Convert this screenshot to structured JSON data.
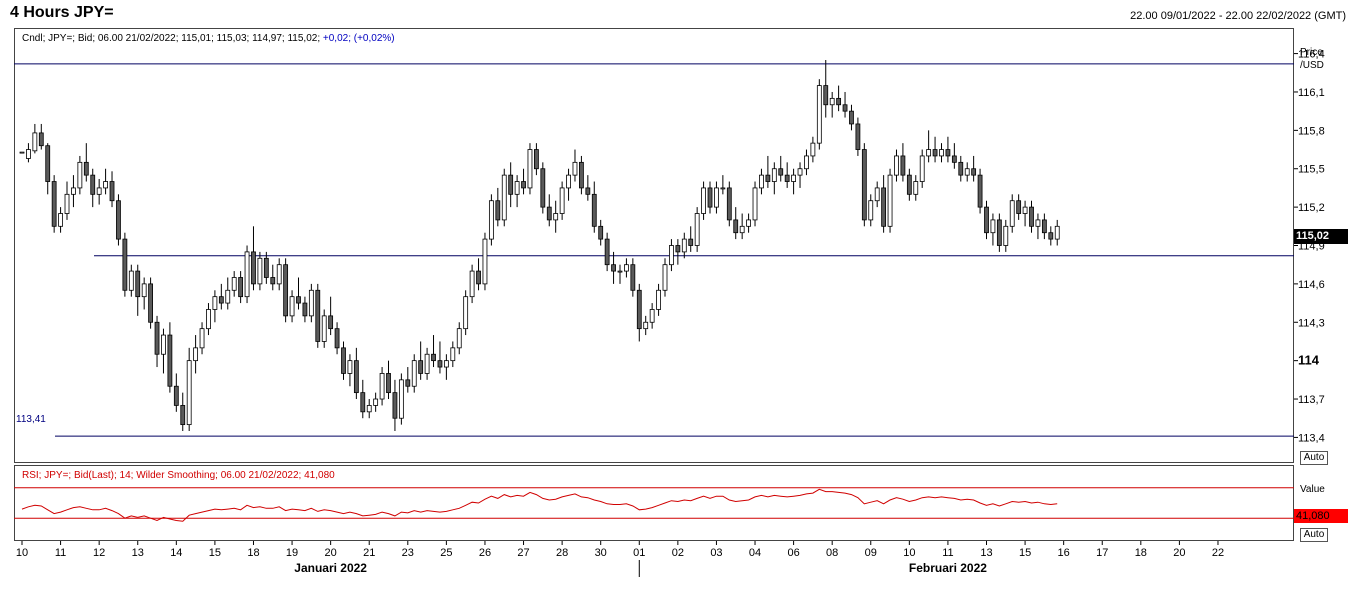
{
  "header": {
    "title": "4 Hours JPY=",
    "date_range": "22.00 09/01/2022 - 22.00 22/02/2022 (GMT)"
  },
  "price_panel": {
    "legend": "Cndl; JPY=; Bid; 06.00 21/02/2022; 115,01; 115,03; 114,97; 115,02;",
    "legend_change": "+0,02; (+0,02%)",
    "axis_title_1": "Price",
    "axis_title_2": "/USD",
    "auto_label": "Auto",
    "last_price_label": "115,02",
    "support_low_label": "113,41"
  },
  "rsi_panel": {
    "legend": "RSI; JPY=; Bid(Last); 14; Wilder Smoothing; 06.00 21/02/2022; 41,080",
    "axis_title": "Value",
    "auto_label": "Auto",
    "last_value_label": "41,080"
  },
  "colors": {
    "bull": "#ffffff",
    "bear": "#5a5a5a",
    "candle_outline": "#000000",
    "hline": "#000060",
    "rsi_line": "#d00000",
    "last_price_bg": "#000000",
    "last_rsi_bg": "#ff0000"
  },
  "chart_data": {
    "type": "candlestick",
    "y_axis": {
      "min": 113.2,
      "max": 116.6,
      "ticks": [
        {
          "value": 113.4,
          "label": "113,4"
        },
        {
          "value": 113.7,
          "label": "113,7"
        },
        {
          "value": 114.0,
          "label": "114",
          "bold": true
        },
        {
          "value": 114.3,
          "label": "114,3"
        },
        {
          "value": 114.6,
          "label": "114,6"
        },
        {
          "value": 114.9,
          "label": "114,9"
        },
        {
          "value": 115.2,
          "label": "115,2"
        },
        {
          "value": 115.5,
          "label": "115,5"
        },
        {
          "value": 115.8,
          "label": "115,8"
        },
        {
          "value": 116.1,
          "label": "116,1"
        },
        {
          "value": 116.4,
          "label": "116,4"
        }
      ]
    },
    "horizontal_lines": [
      116.32,
      114.82,
      113.41
    ],
    "x_axis": {
      "day_ticks": [
        {
          "label": "10",
          "idx": 0
        },
        {
          "label": "11",
          "idx": 6
        },
        {
          "label": "12",
          "idx": 12
        },
        {
          "label": "13",
          "idx": 18
        },
        {
          "label": "14",
          "idx": 24
        },
        {
          "label": "15",
          "idx": 30
        },
        {
          "label": "18",
          "idx": 36
        },
        {
          "label": "19",
          "idx": 42
        },
        {
          "label": "20",
          "idx": 48
        },
        {
          "label": "21",
          "idx": 54
        },
        {
          "label": "23",
          "idx": 60
        },
        {
          "label": "25",
          "idx": 66
        },
        {
          "label": "26",
          "idx": 72
        },
        {
          "label": "27",
          "idx": 78
        },
        {
          "label": "28",
          "idx": 84
        },
        {
          "label": "30",
          "idx": 90
        },
        {
          "label": "01",
          "idx": 96
        },
        {
          "label": "02",
          "idx": 102
        },
        {
          "label": "03",
          "idx": 108
        },
        {
          "label": "04",
          "idx": 114
        },
        {
          "label": "06",
          "idx": 120
        },
        {
          "label": "08",
          "idx": 126
        },
        {
          "label": "09",
          "idx": 132
        },
        {
          "label": "10",
          "idx": 138
        },
        {
          "label": "11",
          "idx": 144
        },
        {
          "label": "13",
          "idx": 150
        },
        {
          "label": "15",
          "idx": 156
        },
        {
          "label": "16",
          "idx": 162
        },
        {
          "label": "17",
          "idx": 168
        },
        {
          "label": "18",
          "idx": 174
        },
        {
          "label": "20",
          "idx": 180
        },
        {
          "label": "22",
          "idx": 186
        }
      ],
      "months": [
        {
          "label": "Januari 2022",
          "idx": 48
        },
        {
          "label": "Februari 2022",
          "idx": 144
        }
      ],
      "month_boundary_idx": 96
    },
    "candles": [
      [
        115.63,
        115.63,
        115.63,
        115.63
      ],
      [
        115.58,
        115.7,
        115.55,
        115.65
      ],
      [
        115.64,
        115.85,
        115.62,
        115.78
      ],
      [
        115.78,
        115.85,
        115.65,
        115.68
      ],
      [
        115.68,
        115.7,
        115.3,
        115.4
      ],
      [
        115.4,
        115.45,
        115.0,
        115.05
      ],
      [
        115.05,
        115.2,
        115.0,
        115.15
      ],
      [
        115.15,
        115.4,
        115.1,
        115.3
      ],
      [
        115.3,
        115.45,
        115.2,
        115.35
      ],
      [
        115.35,
        115.6,
        115.3,
        115.55
      ],
      [
        115.55,
        115.7,
        115.4,
        115.45
      ],
      [
        115.45,
        115.5,
        115.2,
        115.3
      ],
      [
        115.3,
        115.42,
        115.22,
        115.35
      ],
      [
        115.35,
        115.5,
        115.3,
        115.4
      ],
      [
        115.4,
        115.48,
        115.2,
        115.25
      ],
      [
        115.25,
        115.3,
        114.9,
        114.95
      ],
      [
        114.95,
        115.0,
        114.5,
        114.55
      ],
      [
        114.55,
        114.75,
        114.5,
        114.7
      ],
      [
        114.7,
        114.75,
        114.35,
        114.5
      ],
      [
        114.5,
        114.65,
        114.4,
        114.6
      ],
      [
        114.6,
        114.65,
        114.25,
        114.3
      ],
      [
        114.3,
        114.35,
        113.95,
        114.05
      ],
      [
        114.05,
        114.25,
        113.9,
        114.2
      ],
      [
        114.2,
        114.3,
        113.75,
        113.8
      ],
      [
        113.8,
        113.9,
        113.6,
        113.65
      ],
      [
        113.65,
        113.75,
        113.45,
        113.5
      ],
      [
        113.5,
        114.1,
        113.45,
        114.0
      ],
      [
        114.0,
        114.2,
        113.9,
        114.1
      ],
      [
        114.1,
        114.3,
        114.05,
        114.25
      ],
      [
        114.25,
        114.45,
        114.2,
        114.4
      ],
      [
        114.4,
        114.55,
        114.3,
        114.5
      ],
      [
        114.5,
        114.6,
        114.4,
        114.45
      ],
      [
        114.45,
        114.65,
        114.4,
        114.55
      ],
      [
        114.55,
        114.7,
        114.5,
        114.65
      ],
      [
        114.65,
        114.7,
        114.45,
        114.5
      ],
      [
        114.5,
        114.9,
        114.45,
        114.85
      ],
      [
        114.85,
        115.05,
        114.55,
        114.6
      ],
      [
        114.6,
        114.85,
        114.55,
        114.8
      ],
      [
        114.8,
        114.85,
        114.6,
        114.65
      ],
      [
        114.65,
        114.75,
        114.55,
        114.6
      ],
      [
        114.6,
        114.8,
        114.55,
        114.75
      ],
      [
        114.75,
        114.8,
        114.3,
        114.35
      ],
      [
        114.35,
        114.55,
        114.3,
        114.5
      ],
      [
        114.5,
        114.65,
        114.4,
        114.45
      ],
      [
        114.45,
        114.5,
        114.3,
        114.35
      ],
      [
        114.35,
        114.6,
        114.3,
        114.55
      ],
      [
        114.55,
        114.6,
        114.1,
        114.15
      ],
      [
        114.15,
        114.4,
        114.1,
        114.35
      ],
      [
        114.35,
        114.5,
        114.2,
        114.25
      ],
      [
        114.25,
        114.3,
        114.05,
        114.1
      ],
      [
        114.1,
        114.15,
        113.85,
        113.9
      ],
      [
        113.9,
        114.05,
        113.8,
        114.0
      ],
      [
        114.0,
        114.1,
        113.7,
        113.75
      ],
      [
        113.75,
        113.85,
        113.55,
        113.6
      ],
      [
        113.6,
        113.7,
        113.55,
        113.65
      ],
      [
        113.65,
        113.75,
        113.6,
        113.7
      ],
      [
        113.7,
        113.95,
        113.65,
        113.9
      ],
      [
        113.9,
        114.0,
        113.7,
        113.75
      ],
      [
        113.75,
        113.85,
        113.45,
        113.55
      ],
      [
        113.55,
        113.9,
        113.5,
        113.85
      ],
      [
        113.85,
        113.95,
        113.75,
        113.8
      ],
      [
        113.8,
        114.05,
        113.75,
        114.0
      ],
      [
        114.0,
        114.15,
        113.85,
        113.9
      ],
      [
        113.9,
        114.1,
        113.85,
        114.05
      ],
      [
        114.05,
        114.2,
        113.95,
        114.0
      ],
      [
        114.0,
        114.15,
        113.9,
        113.95
      ],
      [
        113.95,
        114.05,
        113.85,
        114.0
      ],
      [
        114.0,
        114.15,
        113.95,
        114.1
      ],
      [
        114.1,
        114.3,
        114.05,
        114.25
      ],
      [
        114.25,
        114.55,
        114.2,
        114.5
      ],
      [
        114.5,
        114.75,
        114.45,
        114.7
      ],
      [
        114.7,
        114.8,
        114.55,
        114.6
      ],
      [
        114.6,
        115.0,
        114.55,
        114.95
      ],
      [
        114.95,
        115.3,
        114.9,
        115.25
      ],
      [
        115.25,
        115.35,
        115.05,
        115.1
      ],
      [
        115.1,
        115.5,
        115.05,
        115.45
      ],
      [
        115.45,
        115.55,
        115.2,
        115.3
      ],
      [
        115.3,
        115.45,
        115.2,
        115.4
      ],
      [
        115.4,
        115.5,
        115.3,
        115.35
      ],
      [
        115.35,
        115.7,
        115.3,
        115.65
      ],
      [
        115.65,
        115.7,
        115.45,
        115.5
      ],
      [
        115.5,
        115.55,
        115.15,
        115.2
      ],
      [
        115.2,
        115.3,
        115.05,
        115.1
      ],
      [
        115.1,
        115.25,
        115.0,
        115.15
      ],
      [
        115.15,
        115.4,
        115.1,
        115.35
      ],
      [
        115.35,
        115.5,
        115.25,
        115.45
      ],
      [
        115.45,
        115.65,
        115.4,
        115.55
      ],
      [
        115.55,
        115.6,
        115.3,
        115.35
      ],
      [
        115.35,
        115.45,
        115.25,
        115.3
      ],
      [
        115.3,
        115.4,
        115.0,
        115.05
      ],
      [
        115.05,
        115.1,
        114.9,
        114.95
      ],
      [
        114.95,
        115.0,
        114.7,
        114.75
      ],
      [
        114.75,
        114.85,
        114.6,
        114.7
      ],
      [
        114.7,
        114.75,
        114.6,
        114.7
      ],
      [
        114.7,
        114.8,
        114.65,
        114.75
      ],
      [
        114.75,
        114.8,
        114.5,
        114.55
      ],
      [
        114.55,
        114.6,
        114.15,
        114.25
      ],
      [
        114.25,
        114.35,
        114.2,
        114.3
      ],
      [
        114.3,
        114.45,
        114.25,
        114.4
      ],
      [
        114.4,
        114.6,
        114.35,
        114.55
      ],
      [
        114.55,
        114.8,
        114.5,
        114.75
      ],
      [
        114.75,
        114.95,
        114.7,
        114.9
      ],
      [
        114.9,
        114.95,
        114.75,
        114.85
      ],
      [
        114.85,
        115.0,
        114.8,
        114.95
      ],
      [
        114.95,
        115.05,
        114.85,
        114.9
      ],
      [
        114.9,
        115.2,
        114.85,
        115.15
      ],
      [
        115.15,
        115.4,
        115.1,
        115.35
      ],
      [
        115.35,
        115.4,
        115.15,
        115.2
      ],
      [
        115.2,
        115.4,
        115.15,
        115.35
      ],
      [
        115.35,
        115.45,
        115.3,
        115.35
      ],
      [
        115.35,
        115.4,
        115.05,
        115.1
      ],
      [
        115.1,
        115.2,
        114.95,
        115.0
      ],
      [
        115.0,
        115.15,
        114.95,
        115.05
      ],
      [
        115.05,
        115.15,
        115.0,
        115.1
      ],
      [
        115.1,
        115.4,
        115.05,
        115.35
      ],
      [
        115.35,
        115.5,
        115.3,
        115.45
      ],
      [
        115.45,
        115.6,
        115.35,
        115.4
      ],
      [
        115.4,
        115.55,
        115.3,
        115.5
      ],
      [
        115.5,
        115.6,
        115.4,
        115.45
      ],
      [
        115.45,
        115.55,
        115.35,
        115.4
      ],
      [
        115.4,
        115.5,
        115.3,
        115.45
      ],
      [
        115.45,
        115.55,
        115.35,
        115.5
      ],
      [
        115.5,
        115.65,
        115.45,
        115.6
      ],
      [
        115.6,
        115.75,
        115.55,
        115.7
      ],
      [
        115.7,
        116.2,
        115.65,
        116.15
      ],
      [
        116.15,
        116.35,
        115.9,
        116.0
      ],
      [
        116.0,
        116.1,
        115.9,
        116.05
      ],
      [
        116.05,
        116.15,
        115.95,
        116.0
      ],
      [
        116.0,
        116.1,
        115.9,
        115.95
      ],
      [
        115.95,
        116.0,
        115.8,
        115.85
      ],
      [
        115.85,
        115.9,
        115.6,
        115.65
      ],
      [
        115.65,
        115.7,
        115.05,
        115.1
      ],
      [
        115.1,
        115.3,
        115.05,
        115.25
      ],
      [
        115.25,
        115.4,
        115.2,
        115.35
      ],
      [
        115.35,
        115.45,
        115.0,
        115.05
      ],
      [
        115.05,
        115.5,
        115.0,
        115.45
      ],
      [
        115.45,
        115.65,
        115.4,
        115.6
      ],
      [
        115.6,
        115.7,
        115.4,
        115.45
      ],
      [
        115.45,
        115.5,
        115.25,
        115.3
      ],
      [
        115.3,
        115.45,
        115.25,
        115.4
      ],
      [
        115.4,
        115.65,
        115.35,
        115.6
      ],
      [
        115.6,
        115.8,
        115.55,
        115.65
      ],
      [
        115.65,
        115.75,
        115.55,
        115.6
      ],
      [
        115.6,
        115.7,
        115.55,
        115.65
      ],
      [
        115.65,
        115.75,
        115.55,
        115.6
      ],
      [
        115.6,
        115.7,
        115.5,
        115.55
      ],
      [
        115.55,
        115.6,
        115.4,
        115.45
      ],
      [
        115.45,
        115.55,
        115.4,
        115.5
      ],
      [
        115.5,
        115.6,
        115.4,
        115.45
      ],
      [
        115.45,
        115.5,
        115.15,
        115.2
      ],
      [
        115.2,
        115.25,
        114.95,
        115.0
      ],
      [
        115.0,
        115.15,
        114.9,
        115.1
      ],
      [
        115.1,
        115.15,
        114.85,
        114.9
      ],
      [
        114.9,
        115.1,
        114.85,
        115.05
      ],
      [
        115.05,
        115.3,
        115.0,
        115.25
      ],
      [
        115.25,
        115.3,
        115.1,
        115.15
      ],
      [
        115.15,
        115.25,
        115.05,
        115.2
      ],
      [
        115.2,
        115.25,
        115.0,
        115.05
      ],
      [
        115.05,
        115.15,
        114.95,
        115.1
      ],
      [
        115.1,
        115.15,
        114.95,
        115.0
      ],
      [
        115.0,
        115.05,
        114.9,
        114.95
      ],
      [
        114.95,
        115.1,
        114.9,
        115.05
      ]
    ],
    "rsi": {
      "min": 0,
      "max": 100,
      "levels": [
        70,
        30
      ],
      "values": [
        42,
        45,
        47,
        46,
        41,
        36,
        38,
        41,
        44,
        45,
        43,
        41,
        41,
        43,
        40,
        36,
        30,
        33,
        31,
        33,
        30,
        27,
        31,
        29,
        27,
        26,
        34,
        36,
        38,
        40,
        42,
        41,
        42,
        43,
        41,
        47,
        44,
        45,
        43,
        43,
        45,
        40,
        42,
        41,
        40,
        43,
        39,
        41,
        40,
        38,
        36,
        38,
        36,
        33,
        34,
        35,
        38,
        36,
        33,
        38,
        37,
        40,
        38,
        40,
        39,
        38,
        39,
        41,
        43,
        47,
        51,
        50,
        55,
        59,
        56,
        61,
        58,
        60,
        59,
        64,
        61,
        56,
        54,
        55,
        58,
        60,
        62,
        58,
        57,
        54,
        52,
        49,
        48,
        48,
        49,
        46,
        41,
        42,
        44,
        47,
        50,
        53,
        52,
        54,
        53,
        56,
        59,
        56,
        59,
        59,
        54,
        52,
        53,
        54,
        58,
        60,
        58,
        60,
        59,
        58,
        59,
        60,
        62,
        63,
        68,
        65,
        65,
        64,
        63,
        61,
        57,
        49,
        51,
        53,
        49,
        54,
        57,
        55,
        52,
        54,
        57,
        58,
        57,
        58,
        57,
        56,
        54,
        55,
        54,
        50,
        47,
        49,
        46,
        49,
        52,
        51,
        52,
        50,
        51,
        49,
        48,
        49
      ]
    }
  }
}
